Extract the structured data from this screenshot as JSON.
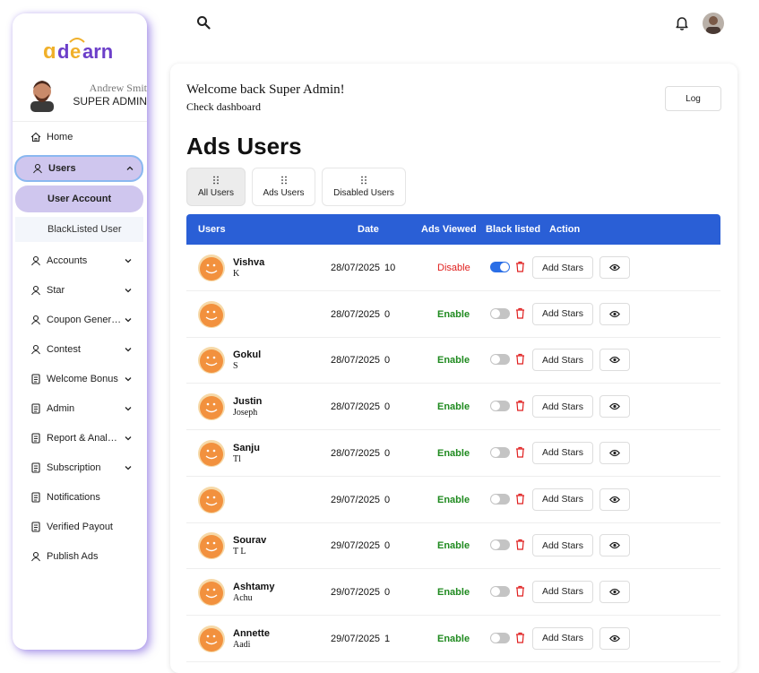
{
  "brand": {
    "logo_text": "adearn"
  },
  "profile": {
    "name": "Andrew Smith",
    "role": "SUPER ADMIN"
  },
  "sidebar": {
    "items": [
      {
        "label": "Home",
        "icon": "home-icon"
      },
      {
        "label": "Users",
        "icon": "user-icon",
        "expanded": true
      },
      {
        "label": "Accounts",
        "icon": "user-icon"
      },
      {
        "label": "Star",
        "icon": "user-icon"
      },
      {
        "label": "Coupon Generator",
        "icon": "user-icon"
      },
      {
        "label": "Contest",
        "icon": "user-icon"
      },
      {
        "label": "Welcome Bonus",
        "icon": "document-icon"
      },
      {
        "label": "Admin",
        "icon": "document-icon"
      },
      {
        "label": "Report & Analytics",
        "icon": "document-icon"
      },
      {
        "label": "Subscription",
        "icon": "document-icon"
      },
      {
        "label": "Notifications",
        "icon": "document-icon"
      },
      {
        "label": "Verified Payout",
        "icon": "document-icon"
      },
      {
        "label": "Publish Ads",
        "icon": "user-icon"
      }
    ],
    "sub_items": [
      {
        "label": "User Account",
        "active": true
      },
      {
        "label": "BlackListed User",
        "active": false
      }
    ]
  },
  "header": {
    "welcome": "Welcome back Super Admin!",
    "subtitle": "Check dashboard",
    "log_button": "Log",
    "page_title": "Ads Users"
  },
  "tabs": [
    {
      "label": "All Users",
      "active": true
    },
    {
      "label": "Ads Users",
      "active": false
    },
    {
      "label": "Disabled Users",
      "active": false
    }
  ],
  "table": {
    "columns": [
      "Users",
      "Date",
      "Ads Viewed",
      "Black listed",
      "Action"
    ],
    "add_stars_label": "Add Stars",
    "rows": [
      {
        "name": "Vishva",
        "sub": "K",
        "date": "28/07/2025",
        "views": "10",
        "status": "Disable",
        "blacklisted": true
      },
      {
        "name": "",
        "sub": "",
        "date": "28/07/2025",
        "views": "0",
        "status": "Enable",
        "blacklisted": false
      },
      {
        "name": "Gokul",
        "sub": "S",
        "date": "28/07/2025",
        "views": "0",
        "status": "Enable",
        "blacklisted": false
      },
      {
        "name": "Justin",
        "sub": "Joseph",
        "date": "28/07/2025",
        "views": "0",
        "status": "Enable",
        "blacklisted": false
      },
      {
        "name": "Sanju",
        "sub": "Tl",
        "date": "28/07/2025",
        "views": "0",
        "status": "Enable",
        "blacklisted": false
      },
      {
        "name": "",
        "sub": "",
        "date": "29/07/2025",
        "views": "0",
        "status": "Enable",
        "blacklisted": false
      },
      {
        "name": "Sourav",
        "sub": "T L",
        "date": "29/07/2025",
        "views": "0",
        "status": "Enable",
        "blacklisted": false
      },
      {
        "name": "Ashtamy",
        "sub": "Achu",
        "date": "29/07/2025",
        "views": "0",
        "status": "Enable",
        "blacklisted": false
      },
      {
        "name": "Annette",
        "sub": "Aadi",
        "date": "29/07/2025",
        "views": "1",
        "status": "Enable",
        "blacklisted": false
      }
    ]
  },
  "colors": {
    "accent": "#2a5fd6",
    "sidebar_active": "#cfc6ee",
    "disable_text": "#e0201e",
    "enable_text": "#1f8a1f",
    "trash": "#e02020",
    "avatar_orange": "#f2913e"
  }
}
